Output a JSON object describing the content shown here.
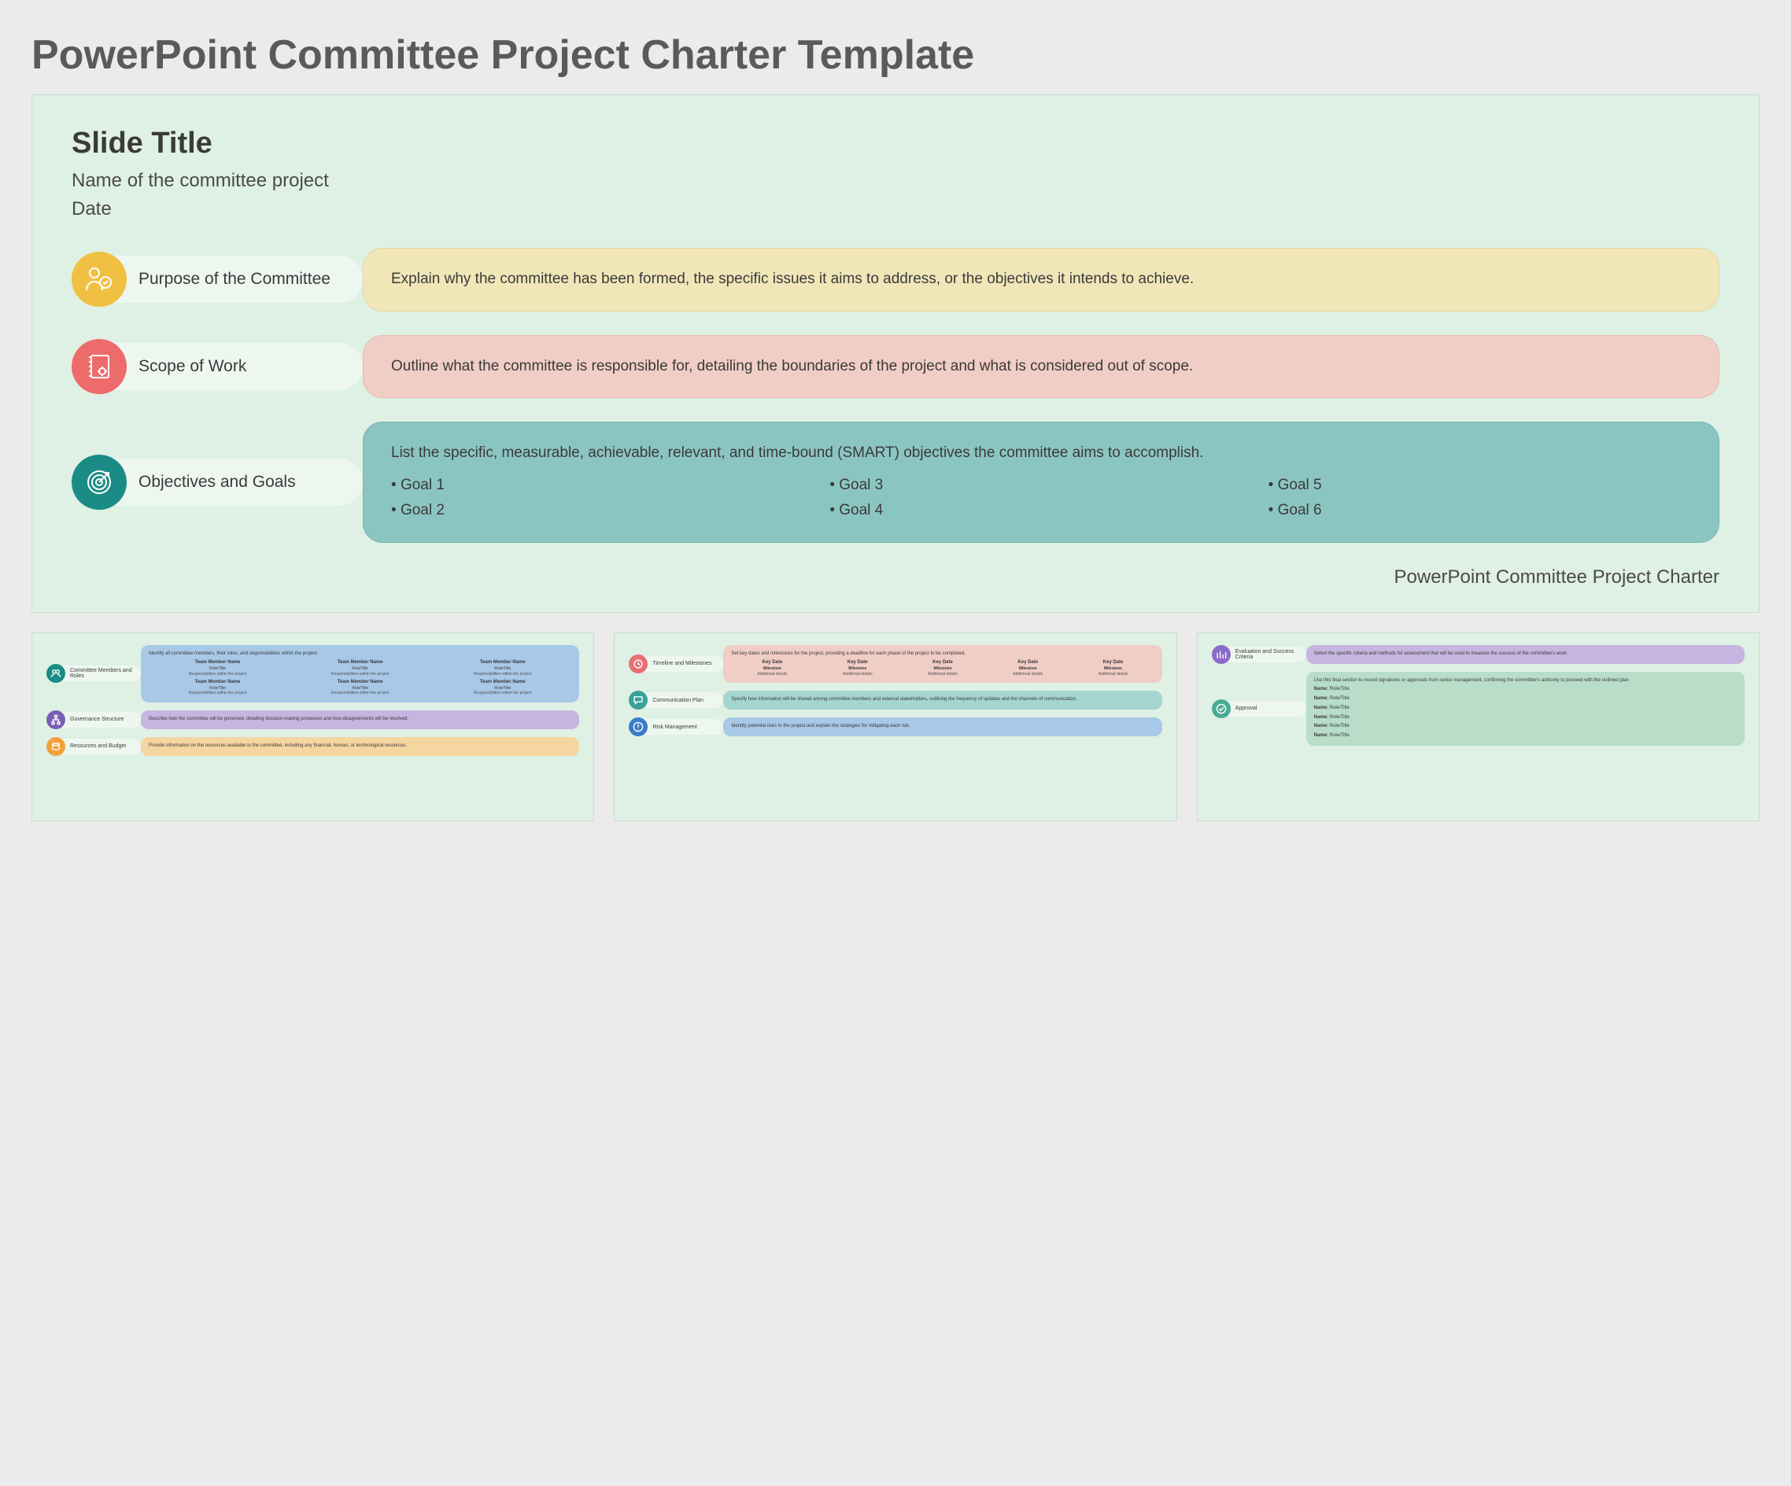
{
  "pageTitle": "PowerPoint Committee Project Charter Template",
  "main": {
    "slideTitle": "Slide Title",
    "subtitle1": "Name of the committee project",
    "subtitle2": "Date",
    "footer": "PowerPoint Committee Project Charter",
    "s1": {
      "label": "Purpose of the Committee",
      "text": "Explain why the committee has been formed, the specific issues it aims to address, or the objectives it intends to achieve."
    },
    "s2": {
      "label": "Scope of Work",
      "text": "Outline what the committee is responsible for, detailing the boundaries of the project and what is considered out of scope."
    },
    "s3": {
      "label": "Objectives and Goals",
      "text": "List the specific, measurable, achievable, relevant, and time-bound (SMART) objectives the committee aims to accomplish.",
      "goals": {
        "g1": "Goal 1",
        "g2": "Goal 2",
        "g3": "Goal 3",
        "g4": "Goal 4",
        "g5": "Goal 5",
        "g6": "Goal 6"
      }
    }
  },
  "thumb1": {
    "s1": {
      "label": "Committee Members and Roles",
      "lead": "Identify all committee members, their roles, and responsibilities within the project.",
      "memberName": "Team Member Name",
      "memberRole": "Role/Title",
      "memberResp": "Responsibilities within the project"
    },
    "s2": {
      "label": "Governance Structure",
      "text": "Describe how the committee will be governed, detailing decision-making processes and how disagreements will be resolved."
    },
    "s3": {
      "label": "Resources and Budget",
      "text": "Provide information on the resources available to the committee, including any financial, human, or technological resources."
    }
  },
  "thumb2": {
    "s1": {
      "label": "Timeline and Milestones",
      "lead": "Set key dates and milestones for the project, providing a deadline for each phase of the project to be completed.",
      "keyDate": "Key Date",
      "milestone": "Milestone",
      "details": "Additional details"
    },
    "s2": {
      "label": "Communication Plan",
      "text": "Specify how information will be shared among committee members and external stakeholders, outlining the frequency of updates and the channels of communication."
    },
    "s3": {
      "label": "Risk Management",
      "text": "Identify potential risks to the project and explain the strategies for mitigating each risk."
    }
  },
  "thumb3": {
    "s1": {
      "label": "Evaluation and Success Criteria",
      "text": "Select the specific criteria and methods for assessment that will be used to measure the success of the committee's work."
    },
    "s2": {
      "label": "Approval",
      "text": "Use this final section to record signatures or approvals from senior management, confirming the committee's authority to proceed with the outlined plan.",
      "name": "Name:",
      "role": "Role/Title"
    }
  }
}
